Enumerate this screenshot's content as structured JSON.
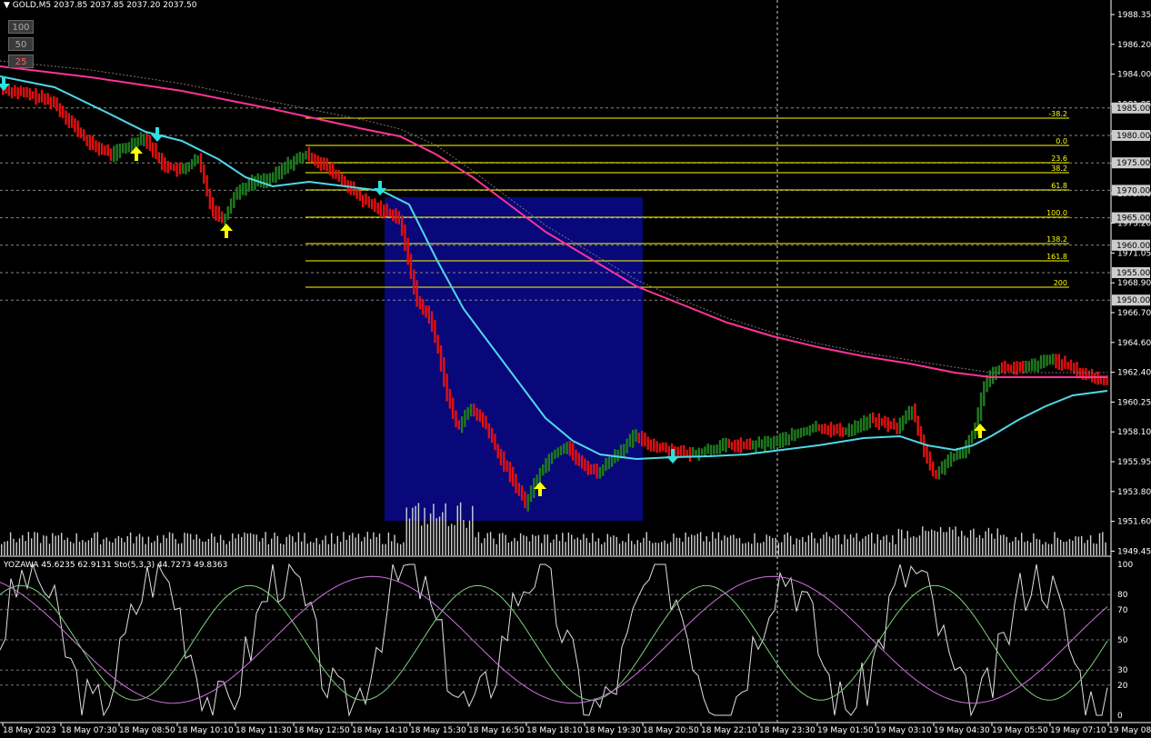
{
  "header": {
    "symbol": "GOLD,M5",
    "ohlc": "2037.85 2037.85 2037.20 2037.50"
  },
  "buttons": [
    {
      "label": "100"
    },
    {
      "label": "50"
    },
    {
      "label": "25"
    }
  ],
  "indicator": {
    "title": "YOZAWA 45.6235 62.9131  Sto(5,3,3) 44.7273 49.8363"
  },
  "price_axis": {
    "ticks": [
      "1988.35",
      "1986.20",
      "1984.00",
      "1981.85",
      "1979.70",
      "1977.55",
      "1975.40",
      "1973.20",
      "1971.05",
      "1968.90",
      "1966.70",
      "1964.60",
      "1962.40",
      "1960.25",
      "1958.10",
      "1955.95",
      "1953.80",
      "1951.60",
      "1949.45"
    ],
    "boxed": [
      "1985.00",
      "1980.00",
      "1975.00",
      "1970.00",
      "1965.00",
      "1960.00",
      "1955.00",
      "1950.00"
    ]
  },
  "indicator_axis": {
    "ticks": [
      "100",
      "80",
      "70",
      "50",
      "30",
      "20",
      "0"
    ]
  },
  "time_axis": {
    "labels": [
      "18 May 2023",
      "18 May 07:30",
      "18 May 08:50",
      "18 May 10:10",
      "18 May 11:30",
      "18 May 12:50",
      "18 May 14:10",
      "18 May 15:30",
      "18 May 16:50",
      "18 May 18:10",
      "18 May 19:30",
      "18 May 20:50",
      "18 May 22:10",
      "18 May 23:30",
      "19 May 01:50",
      "19 May 03:10",
      "19 May 04:30",
      "19 May 05:50",
      "19 May 07:10",
      "19 May 08:30"
    ]
  },
  "fibonacci": {
    "levels": [
      "-38.2",
      "0.0",
      "23.6",
      "38.2",
      "61.8",
      "100.0",
      "138.2",
      "161.8",
      "200"
    ],
    "color": "#ffff00"
  },
  "colors": {
    "background": "#000000",
    "bull": "#1e7a1e",
    "bear": "#e01010",
    "fast_ma": "#4fd8e8",
    "slow_ma": "#ff3399",
    "zone": "#08087a",
    "arrow_up": "#ffff00",
    "arrow_down": "#2ee0e0"
  }
}
